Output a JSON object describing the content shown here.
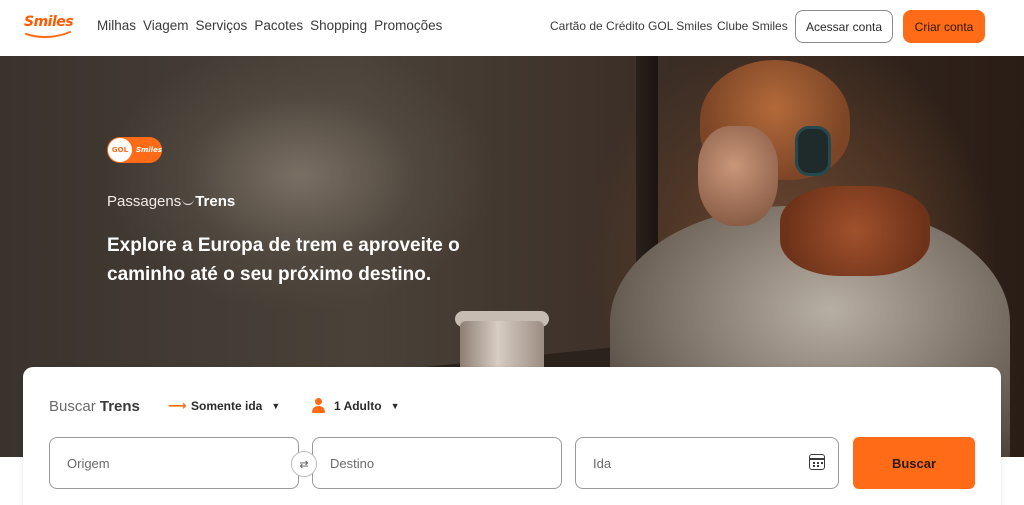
{
  "header": {
    "logo_text": "Smiles",
    "nav": [
      "Milhas",
      "Viagem",
      "Serviços",
      "Pacotes",
      "Shopping",
      "Promoções"
    ],
    "credit_card_link": "Cartão de Crédito GOL Smiles",
    "club_link": "Clube Smiles",
    "login_label": "Acessar conta",
    "signup_label": "Criar conta"
  },
  "hero": {
    "badge_gol": "GOL",
    "badge_smiles": "Smiles",
    "kicker_prefix": "Passagens",
    "kicker_strong": "Trens",
    "headline": "Explore a Europa de trem e aproveite o caminho até o seu próximo destino."
  },
  "search": {
    "title_prefix": "Buscar",
    "title_strong": "Trens",
    "trip_type": "Somente ida",
    "passengers": "1 Adulto",
    "origin_placeholder": "Origem",
    "destination_placeholder": "Destino",
    "date_placeholder": "Ida",
    "submit_label": "Buscar"
  },
  "colors": {
    "brand_orange": "#ff6b17"
  }
}
